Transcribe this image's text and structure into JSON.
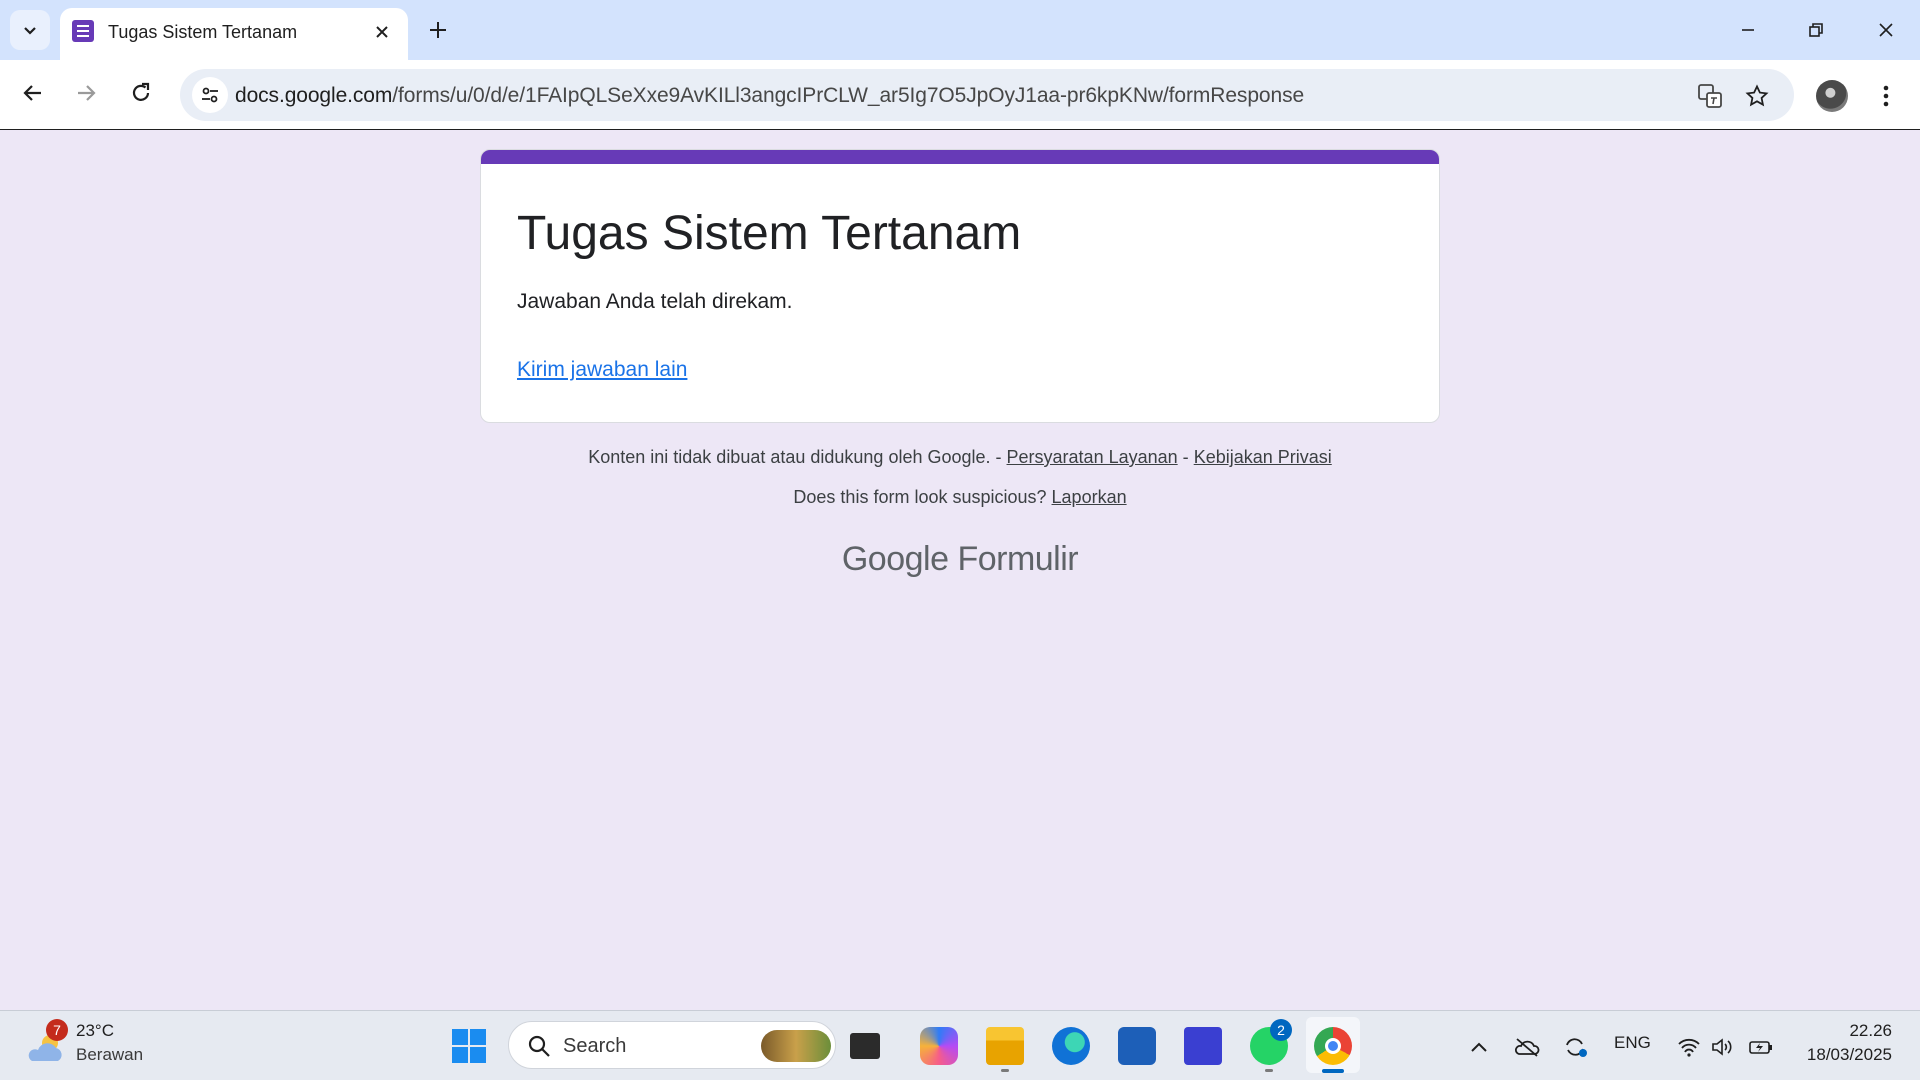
{
  "browser": {
    "tab": {
      "title": "Tugas Sistem Tertanam",
      "favicon": "google-forms-icon"
    },
    "url": {
      "host": "docs.google.com",
      "path": "/forms/u/0/d/e/1FAIpQLSeXxe9AvKILl3angcIPrCLW_ar5Ig7O5JpOyJ1aa-pr6kpKNw/formResponse"
    }
  },
  "form": {
    "title": "Tugas Sistem Tertanam",
    "confirmation": "Jawaban Anda telah direkam.",
    "submit_another": "Kirim jawaban lain",
    "accent_color": "#673ab7",
    "background_color": "#ede7f6",
    "link_color": "#1a73e8"
  },
  "footer": {
    "disclaimer": "Konten ini tidak dibuat atau didukung oleh Google. -",
    "separator": "-",
    "terms": "Persyaratan Layanan",
    "privacy": "Kebijakan Privasi",
    "suspicious": "Does this form look suspicious?",
    "report": "Laporkan",
    "brand_google": "Google",
    "brand_product": "Formulir"
  },
  "taskbar": {
    "weather": {
      "badge": "7",
      "temp": "23°C",
      "desc": "Berawan"
    },
    "search_placeholder": "Search",
    "whatsapp_badge": "2",
    "language": "ENG",
    "time": "22.26",
    "date": "18/03/2025"
  }
}
